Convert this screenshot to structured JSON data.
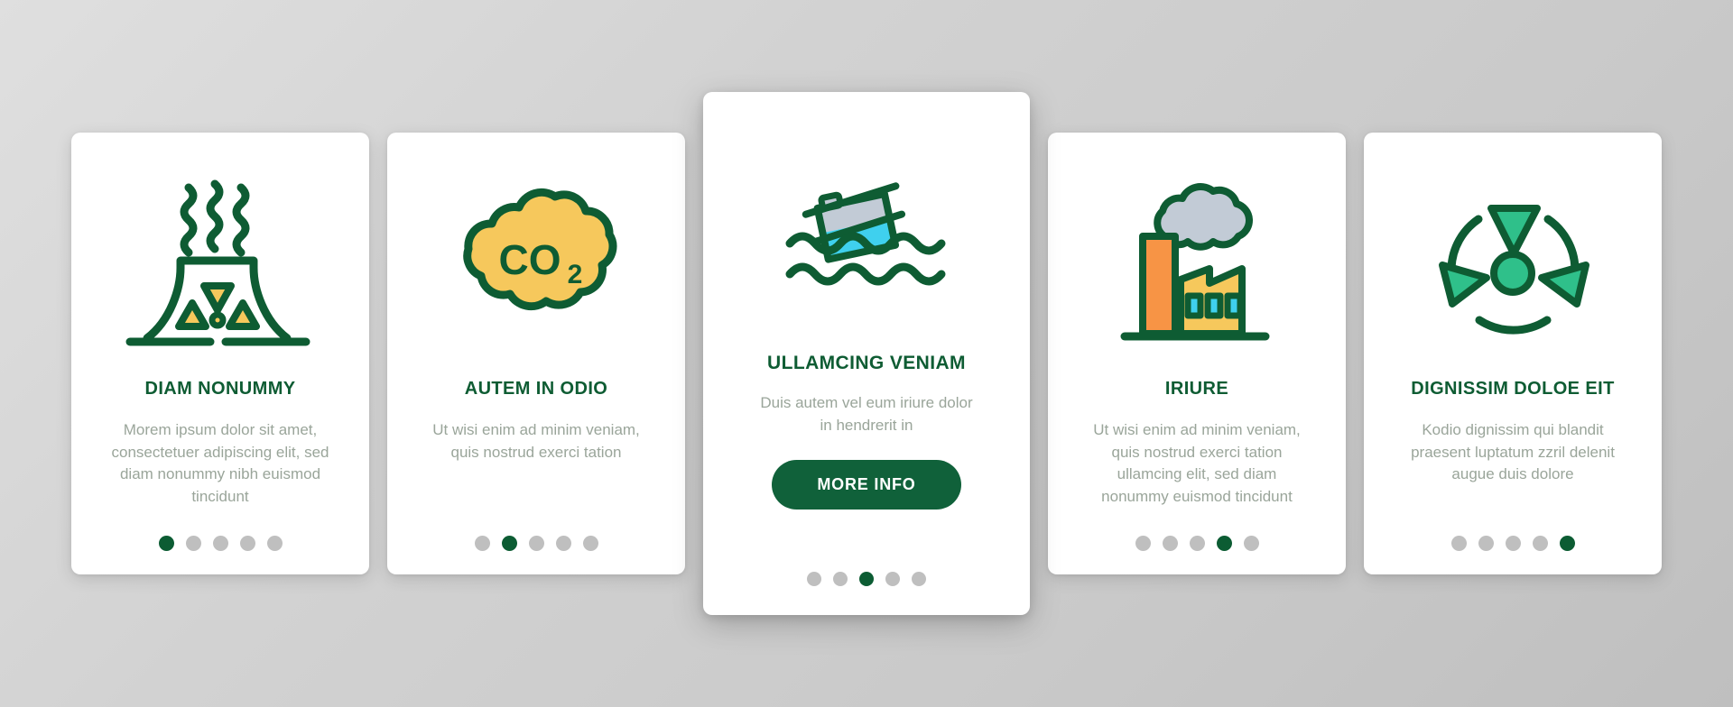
{
  "theme": {
    "primary_green": "#0e5c33",
    "body_text_gray": "#9aa59a",
    "dot_inactive": "#bfbfbf",
    "dot_active": "#0c5c33",
    "accent_yellow": "#f6c85c",
    "accent_orange": "#f79445",
    "accent_cyan": "#3fd0ee",
    "accent_teal": "#2fc08a",
    "accent_gray": "#c2cbd6",
    "card_background": "#ffffff"
  },
  "cards": [
    {
      "id": "diam-nonummy",
      "icon": "nuclear-cooling-tower-icon",
      "title": "DIAM NONUMMY",
      "body": "Morem ipsum dolor sit amet, consectetuer adipiscing elit, sed diam nonummy nibh euismod tincidunt",
      "featured": false,
      "dot_count": 5,
      "active_dot": 0
    },
    {
      "id": "autem-in-odio",
      "icon": "co2-cloud-icon",
      "title": "AUTEM IN ODIO",
      "body": "Ut wisi enim ad minim veniam, quis nostrud exerci tation",
      "featured": false,
      "dot_count": 5,
      "active_dot": 1
    },
    {
      "id": "ullamcing-veniam",
      "icon": "sinking-barrel-water-icon",
      "title": "ULLAMCING VENIAM",
      "body": "Duis autem vel eum iriure dolor in hendrerit in",
      "featured": true,
      "button_label": "MORE INFO",
      "dot_count": 5,
      "active_dot": 2
    },
    {
      "id": "iriure",
      "icon": "factory-smokestack-icon",
      "title": "IRIURE",
      "body": "Ut wisi enim ad minim veniam, quis nostrud exerci tation ullamcing elit, sed diam nonummy euismod tincidunt",
      "featured": false,
      "dot_count": 5,
      "active_dot": 3
    },
    {
      "id": "dignissim-doloe-eit",
      "icon": "radiation-hazard-icon",
      "title": "DIGNISSIM DOLOE EIT",
      "body": "Kodio dignissim qui blandit praesent luptatum zzril delenit augue duis dolore",
      "featured": false,
      "dot_count": 5,
      "active_dot": 4
    }
  ]
}
